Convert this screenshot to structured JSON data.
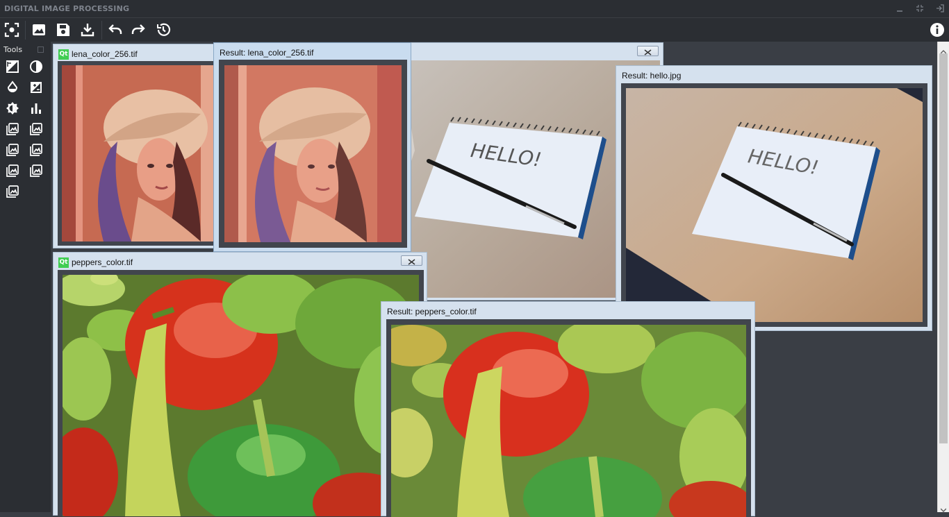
{
  "app": {
    "title": "DIGITAL IMAGE PROCESSING"
  },
  "window_controls": [
    "minimize-icon",
    "restore-icon",
    "exit-icon"
  ],
  "toolbar": {
    "buttons": [
      "select-icon",
      "open-image-icon",
      "save-icon",
      "download-icon",
      "undo-icon",
      "redo-icon",
      "history-icon",
      "info-icon"
    ]
  },
  "tools": {
    "header": "Tools",
    "items": [
      "threshold-icon",
      "contrast-icon",
      "blur-icon",
      "gradient-icon",
      "brightness-icon",
      "histogram-icon",
      "filter-icon",
      "filter-icon",
      "filter-icon",
      "filter-icon",
      "filter-icon",
      "filter-icon",
      "filter-icon"
    ]
  },
  "windows": {
    "lena": {
      "title": "lena_color_256.tif"
    },
    "lena_result": {
      "title": "Result: lena_color_256.tif"
    },
    "hello": {
      "title": ""
    },
    "hello_result": {
      "title": "Result: hello.jpg"
    },
    "peppers": {
      "title": "peppers_color.tif"
    },
    "peppers_result": {
      "title": "Result: peppers_color.tif"
    }
  },
  "colors": {
    "chrome_dark": "#2b2e33",
    "mdi_background": "#3a3e45",
    "subwindow_frame": "#d5e1ee",
    "image_border": "#41454d",
    "qt_green": "#41cd52"
  }
}
